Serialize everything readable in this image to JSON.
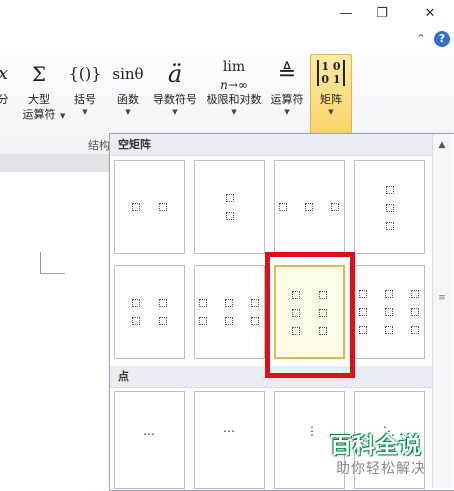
{
  "window": {
    "restore_glyph": "❐",
    "close_glyph": "✕",
    "minimize_ribbon_glyph": "⌃",
    "help_glyph": "?"
  },
  "ribbon": {
    "buttons": [
      {
        "icon": "x",
        "label": "分",
        "has_arrow": false
      },
      {
        "icon": "Σ",
        "label": "大型",
        "label2": "运算符",
        "has_arrow": true
      },
      {
        "icon": "{()}",
        "label": "括号",
        "has_arrow": true
      },
      {
        "icon": "sinθ",
        "label": "函数",
        "has_arrow": true
      },
      {
        "icon": "ä",
        "label": "导数符号",
        "has_arrow": true
      },
      {
        "icon": "lim",
        "label": "极限和对数",
        "has_arrow": true
      },
      {
        "icon": "≜",
        "label": "运算符",
        "has_arrow": true
      },
      {
        "icon": "[10 01]",
        "label": "矩阵",
        "has_arrow": true
      }
    ],
    "group_label": "结构"
  },
  "gallery": {
    "sections": [
      {
        "title": "空矩阵"
      },
      {
        "title": "点"
      }
    ]
  },
  "watermark": {
    "title": "百科全说",
    "subtitle": "助你轻松解决"
  },
  "colors": {
    "highlight_frame": "#d9121a",
    "selected_fill": "#f8d46a"
  }
}
